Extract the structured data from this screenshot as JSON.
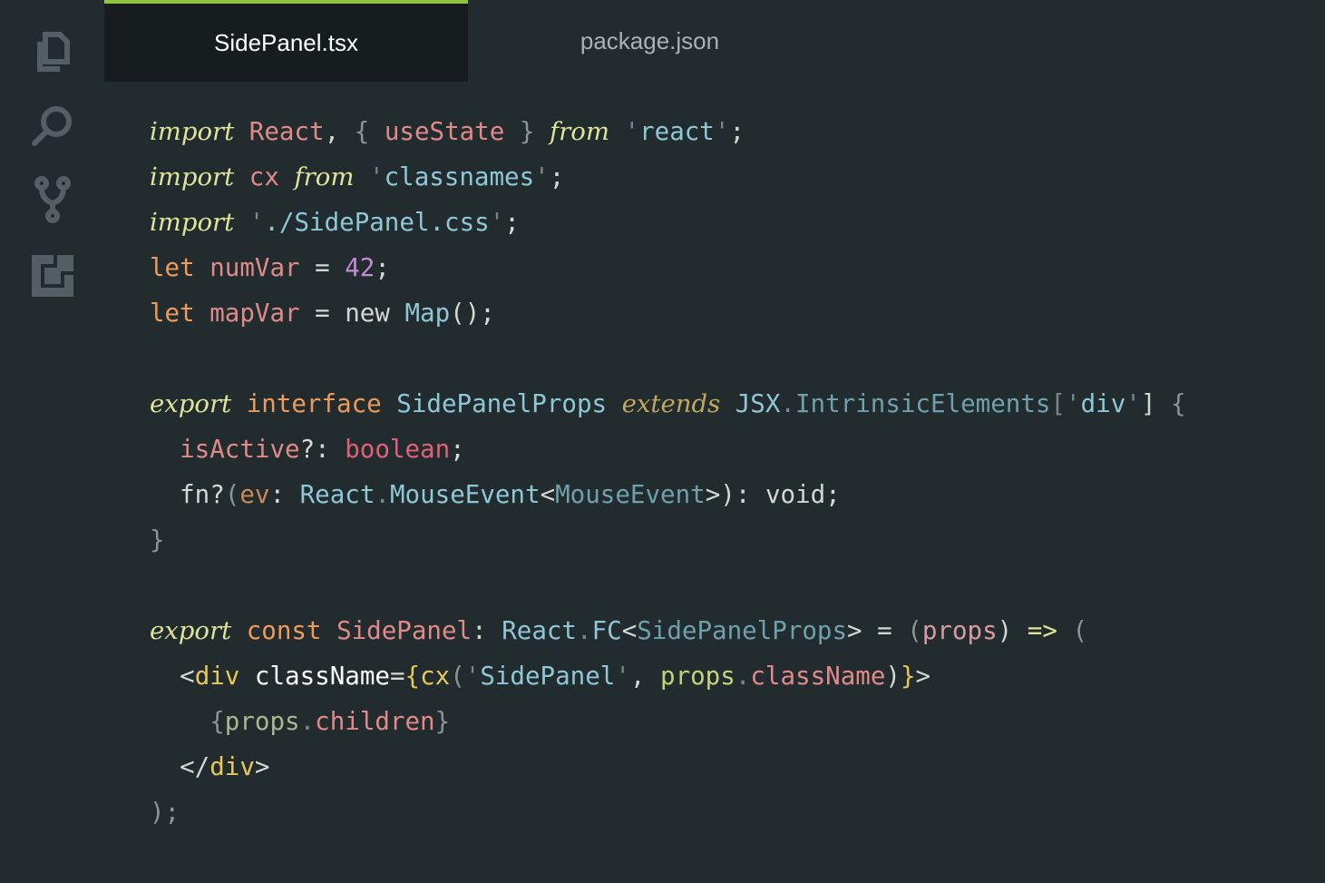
{
  "colors": {
    "background": "#222b2e",
    "active_tab_background": "#171d1f",
    "active_tab_accent": "#8fc43f",
    "icon": "#535f63"
  },
  "activity_bar": {
    "icons": [
      "files-icon",
      "search-icon",
      "source-control-icon",
      "extensions-icon"
    ]
  },
  "tabs": [
    {
      "label": "SidePanel.tsx",
      "active": true
    },
    {
      "label": "package.json",
      "active": false
    }
  ],
  "code": [
    [
      [
        "import",
        "#dfe49a",
        "i"
      ],
      [
        " ",
        ""
      ],
      [
        "React",
        "#e08a8a"
      ],
      [
        ", ",
        "#d5d7d2"
      ],
      [
        "{",
        "#8a9598"
      ],
      [
        " ",
        ""
      ],
      [
        "useState",
        "#e08a8a"
      ],
      [
        " ",
        ""
      ],
      [
        "}",
        "#8a9598"
      ],
      [
        " ",
        ""
      ],
      [
        "from",
        "#dfe49a",
        "i"
      ],
      [
        " ",
        ""
      ],
      [
        "'",
        "#7a878a"
      ],
      [
        "react",
        "#8ec8d7"
      ],
      [
        "'",
        "#7a878a"
      ],
      [
        ";",
        "#d5d7d2"
      ]
    ],
    [
      [
        "import",
        "#dfe49a",
        "i"
      ],
      [
        " ",
        ""
      ],
      [
        "cx",
        "#e08a8a"
      ],
      [
        " ",
        ""
      ],
      [
        "from",
        "#dfe49a",
        "i"
      ],
      [
        " ",
        ""
      ],
      [
        "'",
        "#7a878a"
      ],
      [
        "classnames",
        "#8ec8d7"
      ],
      [
        "'",
        "#7a878a"
      ],
      [
        ";",
        "#d5d7d2"
      ]
    ],
    [
      [
        "import",
        "#dfe49a",
        "i"
      ],
      [
        " ",
        ""
      ],
      [
        "'",
        "#7a878a"
      ],
      [
        "./SidePanel.css",
        "#8ec8d7"
      ],
      [
        "'",
        "#7a878a"
      ],
      [
        ";",
        "#d5d7d2"
      ]
    ],
    [
      [
        "let",
        "#ee9a5a"
      ],
      [
        " ",
        ""
      ],
      [
        "numVar",
        "#e08a8a"
      ],
      [
        " = ",
        "#d5d7d2"
      ],
      [
        "42",
        "#c38ad3"
      ],
      [
        ";",
        "#d5d7d2"
      ]
    ],
    [
      [
        "let",
        "#ee9a5a"
      ],
      [
        " ",
        ""
      ],
      [
        "mapVar",
        "#e08a8a"
      ],
      [
        " = ",
        "#d5d7d2"
      ],
      [
        "new",
        "#d5d7d2"
      ],
      [
        " ",
        ""
      ],
      [
        "Map",
        "#8ec8d7"
      ],
      [
        "();",
        "#d5d7d2"
      ]
    ],
    [],
    [
      [
        "export",
        "#dfe49a",
        "i"
      ],
      [
        " ",
        ""
      ],
      [
        "interface",
        "#ee9a5a"
      ],
      [
        " ",
        ""
      ],
      [
        "SidePanelProps",
        "#8ec8d7"
      ],
      [
        " ",
        ""
      ],
      [
        "extends",
        "#c2a85c",
        "i"
      ],
      [
        " ",
        ""
      ],
      [
        "JSX",
        "#8ec8d7"
      ],
      [
        ".",
        "#7a878a"
      ],
      [
        "IntrinsicElements",
        "#6fa1ad"
      ],
      [
        "[",
        "#7a878a"
      ],
      [
        "'",
        "#7a878a"
      ],
      [
        "div",
        "#8ec8d7"
      ],
      [
        "'",
        "#7a878a"
      ],
      [
        "]",
        "#d5d7d2"
      ],
      [
        " ",
        ""
      ],
      [
        "{",
        "#8a9598"
      ]
    ],
    [
      [
        "  ",
        ""
      ],
      [
        "isActive",
        "#e08a8a"
      ],
      [
        "?: ",
        "#d5d7d2"
      ],
      [
        "boolean",
        "#e0607e"
      ],
      [
        ";",
        "#d5d7d2"
      ]
    ],
    [
      [
        "  ",
        ""
      ],
      [
        "fn",
        "#d5d7d2"
      ],
      [
        "?",
        "#d5d7d2"
      ],
      [
        "(",
        "#8a9598"
      ],
      [
        "ev",
        "#c98a5a"
      ],
      [
        ": ",
        "#d5d7d2"
      ],
      [
        "React",
        "#8ec8d7"
      ],
      [
        ".",
        "#7a878a"
      ],
      [
        "MouseEvent",
        "#8ec8d7"
      ],
      [
        "<",
        "#d5d7d2"
      ],
      [
        "MouseEvent",
        "#6fa1ad"
      ],
      [
        ">): ",
        "#d5d7d2"
      ],
      [
        "void",
        "#d5d7d2"
      ],
      [
        ";",
        "#d5d7d2"
      ]
    ],
    [
      [
        "}",
        "#8a9598"
      ]
    ],
    [],
    [
      [
        "export",
        "#dfe49a",
        "i"
      ],
      [
        " ",
        ""
      ],
      [
        "const",
        "#ee9a5a"
      ],
      [
        " ",
        ""
      ],
      [
        "SidePanel",
        "#e08a8a"
      ],
      [
        ": ",
        "#d5d7d2"
      ],
      [
        "React",
        "#8ec8d7"
      ],
      [
        ".",
        "#7a878a"
      ],
      [
        "FC",
        "#8ec8d7"
      ],
      [
        "<",
        "#d5d7d2"
      ],
      [
        "SidePanelProps",
        "#6fa1ad"
      ],
      [
        "> = ",
        "#d5d7d2"
      ],
      [
        "(",
        "#8a9598"
      ],
      [
        "props",
        "#d99aa0"
      ],
      [
        ")",
        "#d5d7d2"
      ],
      [
        " ",
        ""
      ],
      [
        "=>",
        "#dfe49a"
      ],
      [
        " ",
        ""
      ],
      [
        "(",
        "#8a9598"
      ]
    ],
    [
      [
        "  ",
        ""
      ],
      [
        "<",
        "#d5d7d2"
      ],
      [
        "div",
        "#e7c85a"
      ],
      [
        " ",
        ""
      ],
      [
        "className",
        "#ffffff"
      ],
      [
        "=",
        "#d5d7d2"
      ],
      [
        "{",
        "#e7c85a"
      ],
      [
        "cx",
        "#e7c85a"
      ],
      [
        "(",
        "#8a9598"
      ],
      [
        "'",
        "#7a878a"
      ],
      [
        "SidePanel",
        "#8ec8d7"
      ],
      [
        "'",
        "#7a878a"
      ],
      [
        ", ",
        "#d5d7d2"
      ],
      [
        "props",
        "#c5d27a"
      ],
      [
        ".",
        "#7a878a"
      ],
      [
        "className",
        "#e08a8a"
      ],
      [
        ")",
        "#d5d7d2"
      ],
      [
        "}",
        "#e7c85a"
      ],
      [
        ">",
        "#d5d7d2"
      ]
    ],
    [
      [
        "    ",
        ""
      ],
      [
        "{",
        "#8a9598"
      ],
      [
        "props",
        "#a5bb8d"
      ],
      [
        ".",
        "#7a878a"
      ],
      [
        "children",
        "#e08a8a"
      ],
      [
        "}",
        "#8a9598"
      ]
    ],
    [
      [
        "  ",
        ""
      ],
      [
        "</",
        "#d5d7d2"
      ],
      [
        "div",
        "#e7c85a"
      ],
      [
        ">",
        "#d5d7d2"
      ]
    ],
    [
      [
        ");",
        "#8a9598"
      ]
    ]
  ]
}
